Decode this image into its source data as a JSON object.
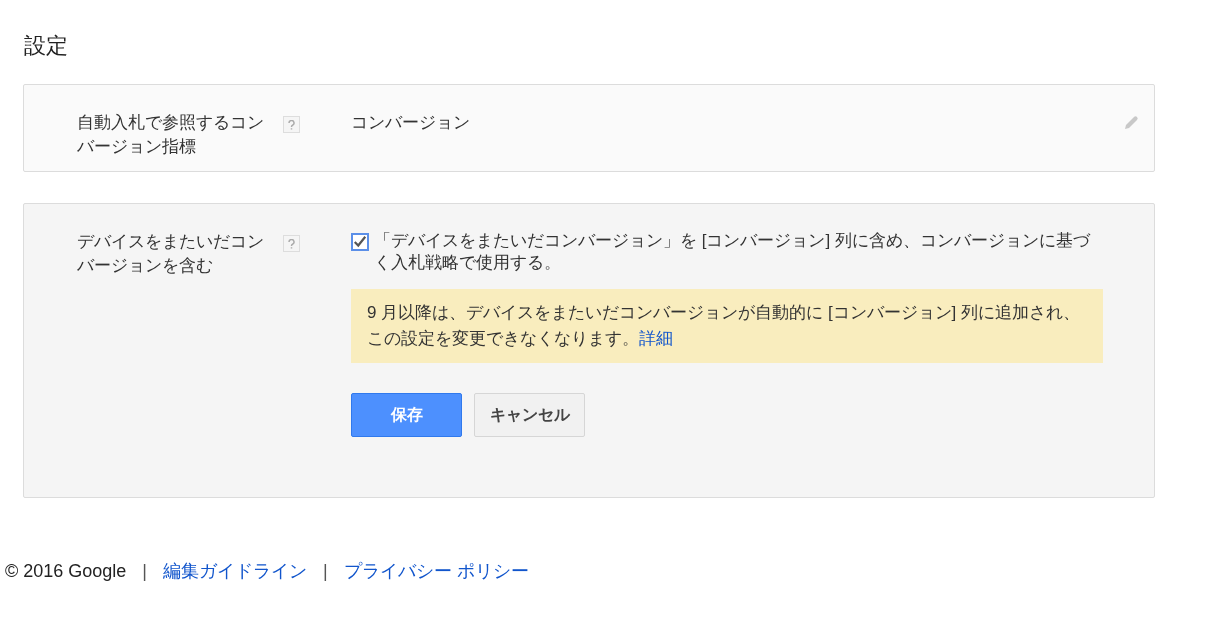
{
  "title": "設定",
  "settings": [
    {
      "kind": "value",
      "label": "自動入札で参照するコンバージョン指標",
      "value": "コンバージョン"
    },
    {
      "kind": "checkbox",
      "label": "デバイスをまたいだコンバージョンを含む",
      "checkbox": {
        "checked": true,
        "text": "「デバイスをまたいだコンバージョン」を [コンバージョン] 列に含め、コンバージョンに基づく入札戦略で使用する。"
      },
      "notice": {
        "text": "9 月以降は、デバイスをまたいだコンバージョンが自動的に [コンバージョン] 列に追加され、この設定を変更できなくなります。",
        "link": "詳細"
      },
      "buttons": [
        {
          "kind": "primary",
          "label": "保存"
        },
        {
          "kind": "secondary",
          "label": "キャンセル"
        }
      ]
    }
  ],
  "footer": [
    {
      "kind": "text",
      "text": "© 2016 Google"
    },
    {
      "kind": "separator",
      "text": "|"
    },
    {
      "kind": "link",
      "text": "編集ガイドライン"
    },
    {
      "kind": "separator",
      "text": "|"
    },
    {
      "kind": "link",
      "text": "プライバシー ポリシー"
    }
  ]
}
